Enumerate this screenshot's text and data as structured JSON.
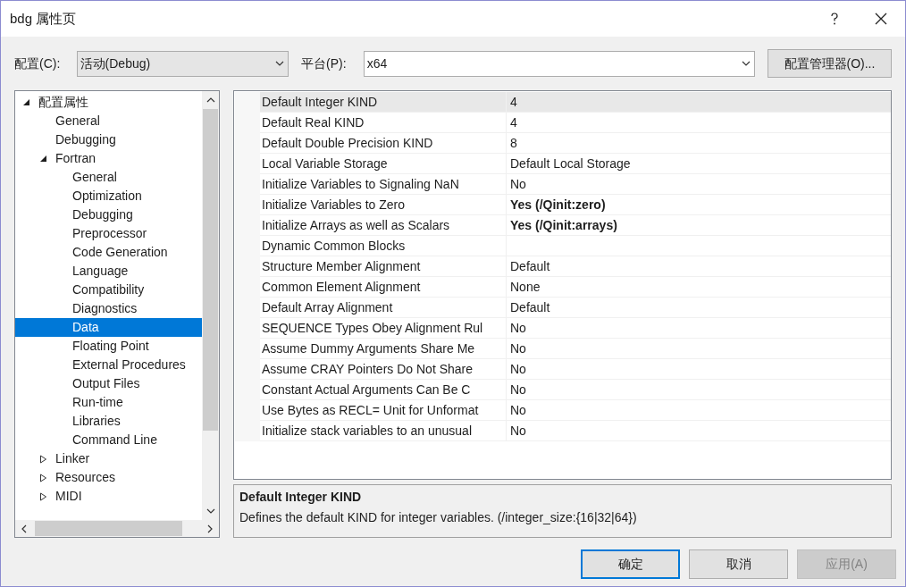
{
  "window": {
    "title": "bdg 属性页"
  },
  "config": {
    "label": "配置(C):",
    "value": "活动(Debug)"
  },
  "platform": {
    "label": "平台(P):",
    "value": "x64"
  },
  "config_manager_button": "配置管理器(O)...",
  "tree": [
    {
      "label": "配置属性",
      "expanded": true,
      "selected": false,
      "children": [
        {
          "label": "General",
          "selected": false
        },
        {
          "label": "Debugging",
          "selected": false
        },
        {
          "label": "Fortran",
          "expanded": true,
          "selected": false,
          "children": [
            {
              "label": "General",
              "selected": false
            },
            {
              "label": "Optimization",
              "selected": false
            },
            {
              "label": "Debugging",
              "selected": false
            },
            {
              "label": "Preprocessor",
              "selected": false
            },
            {
              "label": "Code Generation",
              "selected": false
            },
            {
              "label": "Language",
              "selected": false
            },
            {
              "label": "Compatibility",
              "selected": false
            },
            {
              "label": "Diagnostics",
              "selected": false
            },
            {
              "label": "Data",
              "selected": true
            },
            {
              "label": "Floating Point",
              "selected": false
            },
            {
              "label": "External Procedures",
              "selected": false
            },
            {
              "label": "Output Files",
              "selected": false
            },
            {
              "label": "Run-time",
              "selected": false
            },
            {
              "label": "Libraries",
              "selected": false
            },
            {
              "label": "Command Line",
              "selected": false
            }
          ]
        },
        {
          "label": "Linker",
          "expanded": false,
          "selected": false
        },
        {
          "label": "Resources",
          "expanded": false,
          "selected": false
        },
        {
          "label": "MIDI",
          "expanded": false,
          "selected": false
        }
      ]
    }
  ],
  "properties": [
    {
      "name": "Default Integer KIND",
      "value": "4",
      "modified": false,
      "selected": true
    },
    {
      "name": "Default Real KIND",
      "value": "4",
      "modified": false,
      "selected": false
    },
    {
      "name": "Default Double Precision KIND",
      "value": "8",
      "modified": false,
      "selected": false
    },
    {
      "name": "Local Variable Storage",
      "value": "Default Local Storage",
      "modified": false,
      "selected": false
    },
    {
      "name": "Initialize Variables to Signaling NaN",
      "value": "No",
      "modified": false,
      "selected": false
    },
    {
      "name": "Initialize Variables to Zero",
      "value": "Yes (/Qinit:zero)",
      "modified": true,
      "selected": false
    },
    {
      "name": "Initialize Arrays as well as Scalars",
      "value": "Yes (/Qinit:arrays)",
      "modified": true,
      "selected": false
    },
    {
      "name": "Dynamic Common Blocks",
      "selected": false
    },
    {
      "name": "Structure Member Alignment",
      "value": "Default",
      "modified": false,
      "selected": false
    },
    {
      "name": "Common Element Alignment",
      "value": "None",
      "modified": false,
      "selected": false
    },
    {
      "name": "Default Array Alignment",
      "value": "Default",
      "modified": false,
      "selected": false
    },
    {
      "name": "SEQUENCE Types Obey Alignment Rul",
      "value": "No",
      "modified": false,
      "selected": false
    },
    {
      "name": "Assume Dummy Arguments Share Me",
      "value": "No",
      "modified": false,
      "selected": false
    },
    {
      "name": "Assume CRAY Pointers Do Not Share",
      "value": "No",
      "modified": false,
      "selected": false
    },
    {
      "name": "Constant Actual Arguments Can Be C",
      "value": "No",
      "modified": false,
      "selected": false
    },
    {
      "name": "Use Bytes as RECL= Unit for Unformat",
      "value": "No",
      "modified": false,
      "selected": false
    },
    {
      "name": "Initialize stack variables to an unusual",
      "value": "No",
      "modified": false,
      "selected": false
    }
  ],
  "description": {
    "title": "Default Integer KIND",
    "text": "Defines the default KIND for integer variables. (/integer_size:{16|32|64})"
  },
  "buttons": [
    {
      "label": "确定",
      "default": true,
      "disabled": false
    },
    {
      "label": "取消",
      "default": false,
      "disabled": false
    },
    {
      "label": "应用(A)",
      "default": false,
      "disabled": true
    }
  ]
}
